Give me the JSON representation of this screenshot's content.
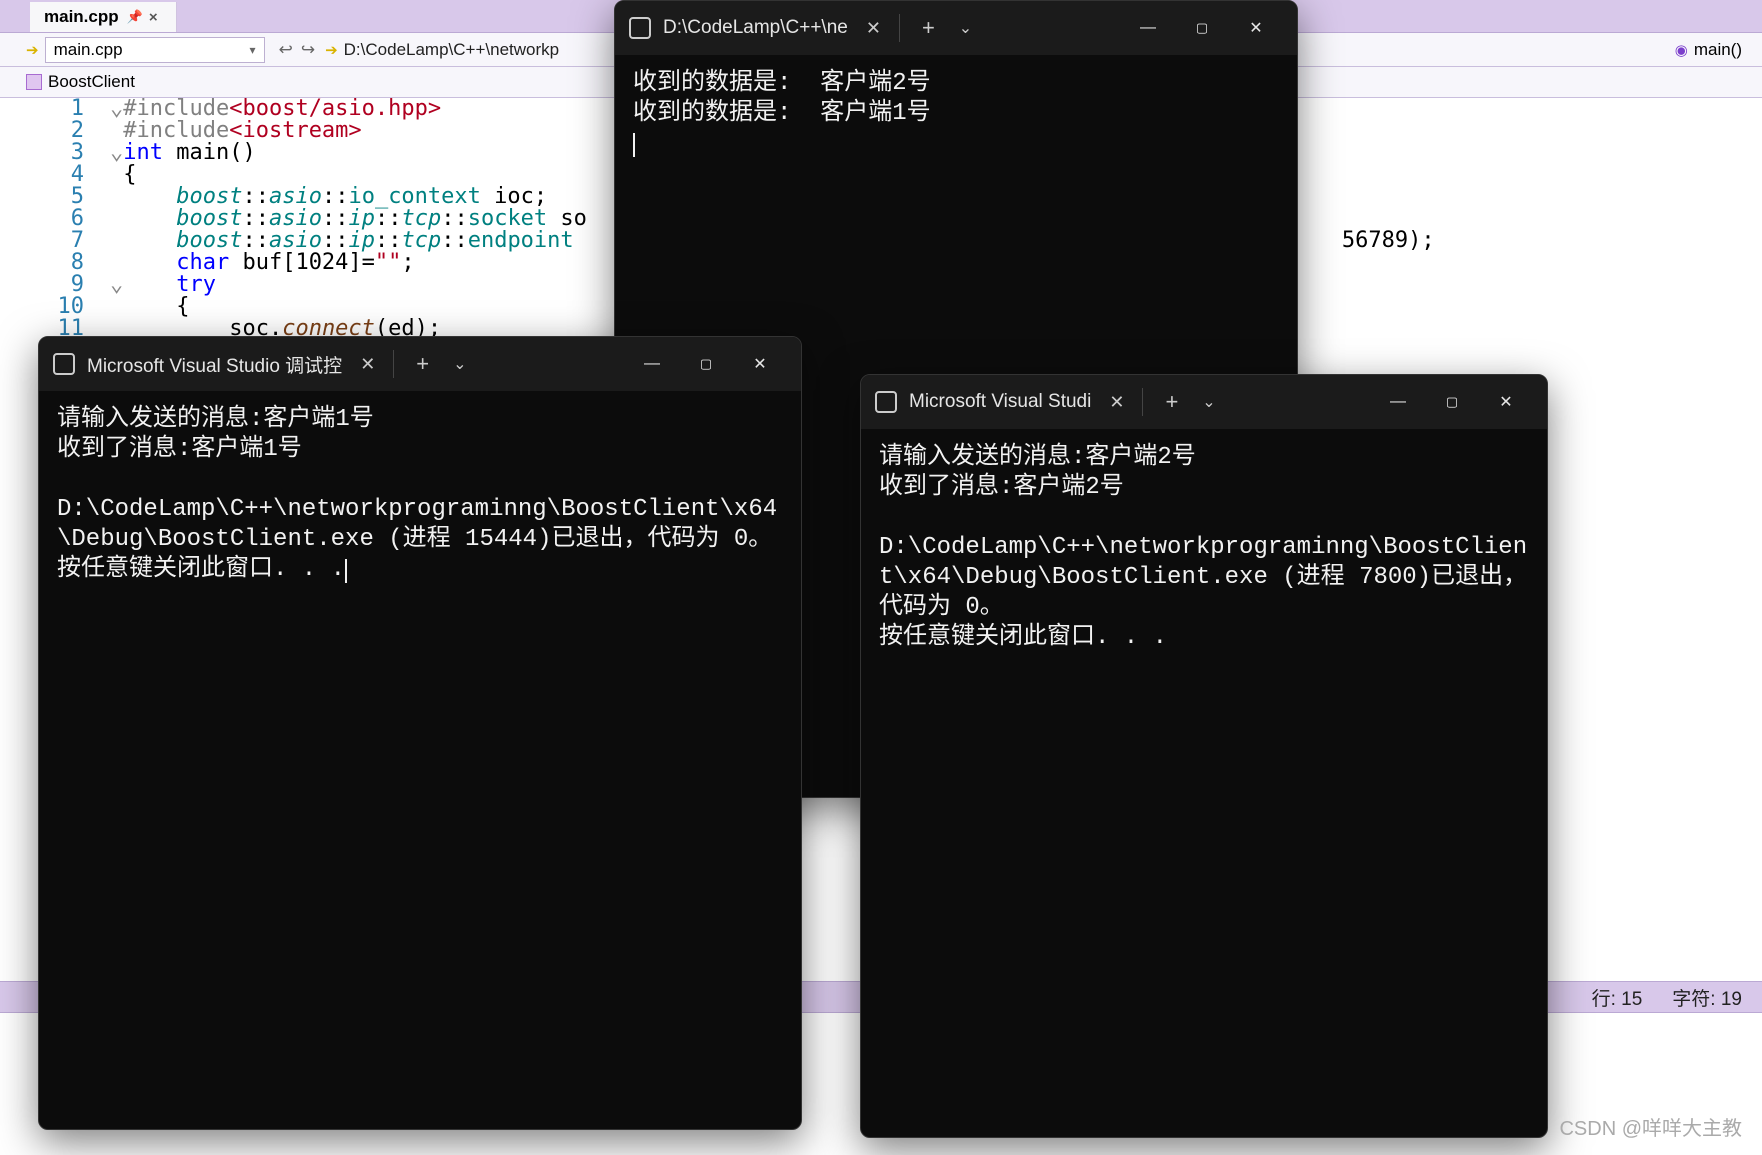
{
  "vs": {
    "tab": {
      "label": "main.cpp",
      "pin": "📌",
      "close": "×"
    },
    "toolbar": {
      "file": "main.cpp",
      "path": "D:\\CodeLamp\\C++\\networkp",
      "right_label": "main()"
    },
    "context": "BoostClient",
    "code_port": "56789);",
    "lines": [
      "1",
      "2",
      "3",
      "4",
      "5",
      "6",
      "7",
      "8",
      "9",
      "10",
      "11"
    ],
    "status": {
      "line": "行: 15",
      "col": "字符: 19"
    }
  },
  "code": {
    "l1a": "#include",
    "l1b": "<boost/asio.hpp>",
    "l2a": "#include",
    "l2b": "<iostream>",
    "l3a": "int",
    "l3b": " main()",
    "l4": "{",
    "l5a": "boost",
    "l5b": "::",
    "l5c": "asio",
    "l5d": "::",
    "l5e": "io_context",
    "l5f": " ioc;",
    "l6a": "boost",
    "l6b": "::",
    "l6c": "asio",
    "l6d": "::",
    "l6e": "ip",
    "l6f": "::",
    "l6g": "tcp",
    "l6h": "::",
    "l6i": "socket",
    "l6j": " so",
    "l7a": "boost",
    "l7b": "::",
    "l7c": "asio",
    "l7d": "::",
    "l7e": "ip",
    "l7f": "::",
    "l7g": "tcp",
    "l7h": "::",
    "l7i": "endpoint",
    "l8a": "char",
    "l8b": " buf[1024]=",
    "l8c": "\"\"",
    "l8d": ";",
    "l9": "try",
    "l10": "{",
    "l11a": "soc.",
    "l11b": "connect",
    "l11c": "(ed);"
  },
  "term1": {
    "title": "D:\\CodeLamp\\C++\\ne",
    "body": "收到的数据是:  客户端2号\n收到的数据是:  客户端1号"
  },
  "term2": {
    "title": "Microsoft Visual Studio 调试控",
    "body": "请输入发送的消息:客户端1号\n收到了消息:客户端1号\n\nD:\\CodeLamp\\C++\\networkprograminng\\BoostClient\\x64\\Debug\\BoostClient.exe (进程 15444)已退出，代码为 0。\n按任意键关闭此窗口. . ."
  },
  "term3": {
    "title": "Microsoft Visual Studi",
    "body": "请输入发送的消息:客户端2号\n收到了消息:客户端2号\n\nD:\\CodeLamp\\C++\\networkprograminng\\BoostClient\\x64\\Debug\\BoostClient.exe (进程 7800)已退出，代码为 0。\n按任意键关闭此窗口. . ."
  },
  "watermark": "CSDN @咩咩大主教"
}
